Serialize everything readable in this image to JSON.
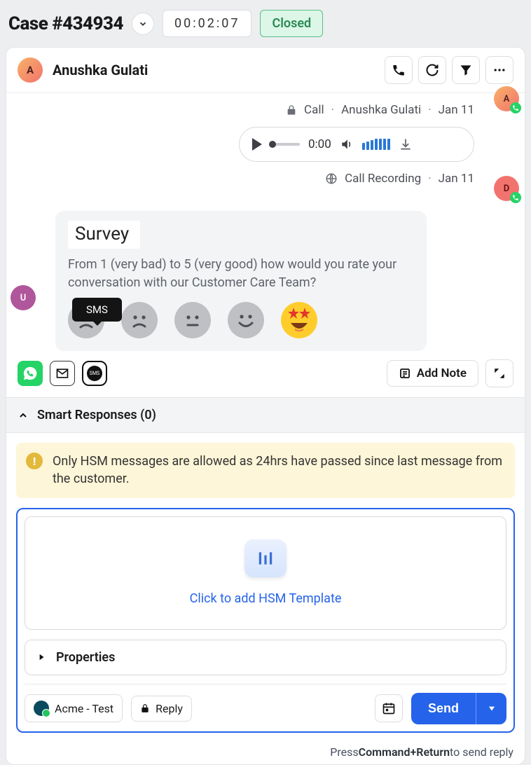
{
  "header": {
    "case_title": "Case #434934",
    "timer": "00:02:07",
    "status": "Closed"
  },
  "contact": {
    "avatar_letter": "A",
    "name": "Anushka Gulati"
  },
  "timeline": {
    "call_meta": {
      "type": "Call",
      "by": "Anushka Gulati",
      "date": "Jan 11"
    },
    "audio": {
      "time": "0:00"
    },
    "recording_meta": {
      "type": "Call Recording",
      "date": "Jan 11"
    },
    "side_a_letter": "A",
    "side_d_letter": "D",
    "u_letter": "U"
  },
  "survey": {
    "title": "Survey",
    "question": "From 1 (very bad) to 5 (very good) how would you rate your conversation with our Customer Care Team?"
  },
  "tooltip": {
    "sms": "SMS"
  },
  "actions": {
    "add_note": "Add Note"
  },
  "smart": {
    "label": "Smart Responses (0)"
  },
  "warning": {
    "text": "Only HSM messages are allowed as 24hrs have passed since last message from the customer."
  },
  "composer": {
    "hsm_cta": "Click to add HSM Template",
    "properties": "Properties",
    "account": "Acme - Test",
    "reply_mode": "Reply",
    "send": "Send"
  },
  "hint": {
    "pre": "Press",
    "key": "Command+Return",
    "post": "to send reply"
  }
}
